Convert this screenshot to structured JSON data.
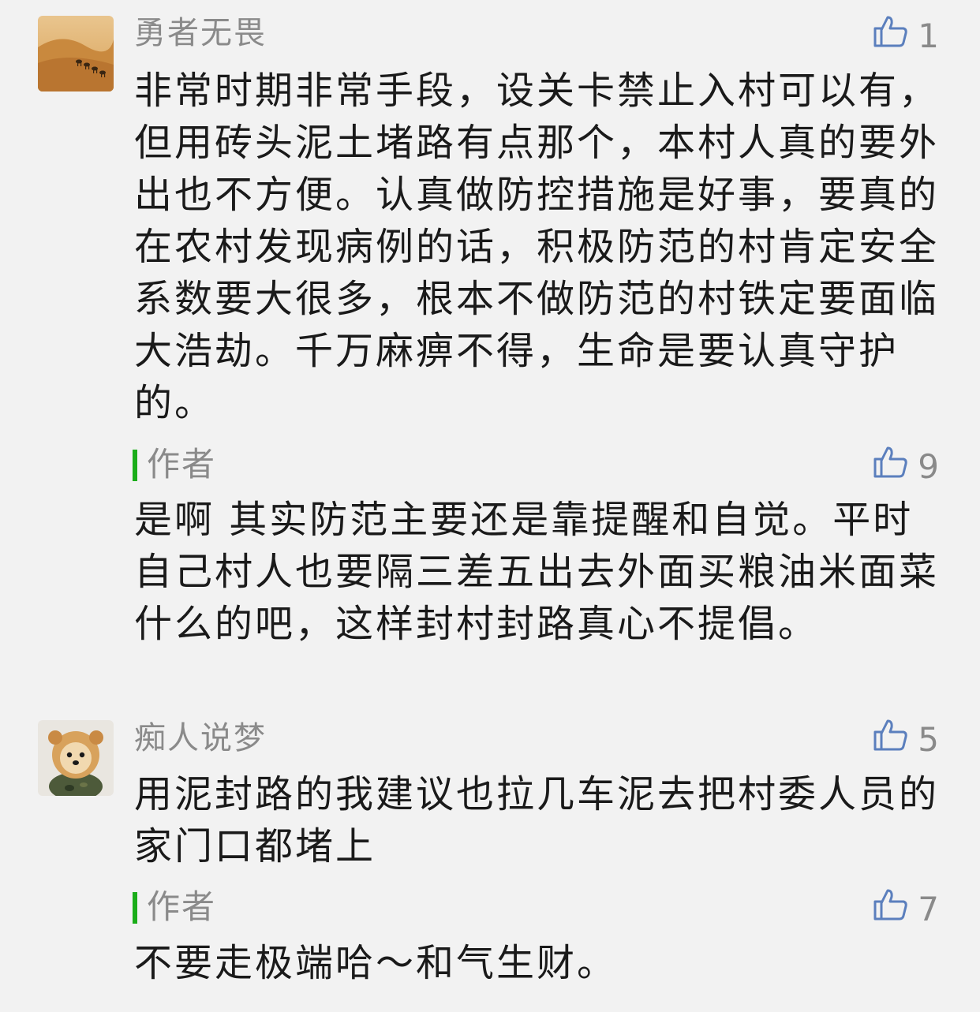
{
  "comments": [
    {
      "username": "勇者无畏",
      "likes": "1",
      "text": "非常时期非常手段，设关卡禁止入村可以有，但用砖头泥土堵路有点那个，本村人真的要外出也不方便。认真做防控措施是好事，要真的在农村发现病例的话，积极防范的村肯定安全系数要大很多，根本不做防范的村铁定要面临大浩劫。千万麻痹不得，生命是要认真守护的。",
      "reply": {
        "label": "作者",
        "likes": "9",
        "text": "是啊 其实防范主要还是靠提醒和自觉。平时自己村人也要隔三差五出去外面买粮油米面菜什么的吧，这样封村封路真心不提倡。"
      }
    },
    {
      "username": "痴人说梦",
      "likes": "5",
      "text": "用泥封路的我建议也拉几车泥去把村委人员的家门口都堵上",
      "reply": {
        "label": "作者",
        "likes": "7",
        "text": "不要走极端哈～和气生财。"
      }
    }
  ],
  "colors": {
    "background": "#f2f2f2",
    "meta_text": "#8a8a8a",
    "body_text": "#1a1a1a",
    "author_bar": "#1aad19"
  },
  "icons": {
    "like": "thumbs-up-icon"
  }
}
